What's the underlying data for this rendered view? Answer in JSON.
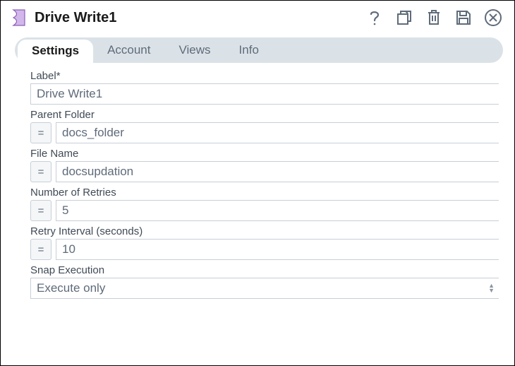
{
  "title": "Drive Write1",
  "tabs": {
    "settings": "Settings",
    "account": "Account",
    "views": "Views",
    "info": "Info"
  },
  "fields": {
    "label": {
      "caption": "Label*",
      "value": "Drive Write1"
    },
    "parent_folder": {
      "caption": "Parent Folder",
      "value": "docs_folder",
      "eq": "="
    },
    "file_name": {
      "caption": "File Name",
      "value": "docsupdation",
      "eq": "="
    },
    "retries": {
      "caption": "Number of Retries",
      "value": "5",
      "eq": "="
    },
    "retry_interval": {
      "caption": "Retry Interval (seconds)",
      "value": "10",
      "eq": "="
    },
    "snap_execution": {
      "caption": "Snap Execution",
      "value": "Execute only"
    }
  }
}
